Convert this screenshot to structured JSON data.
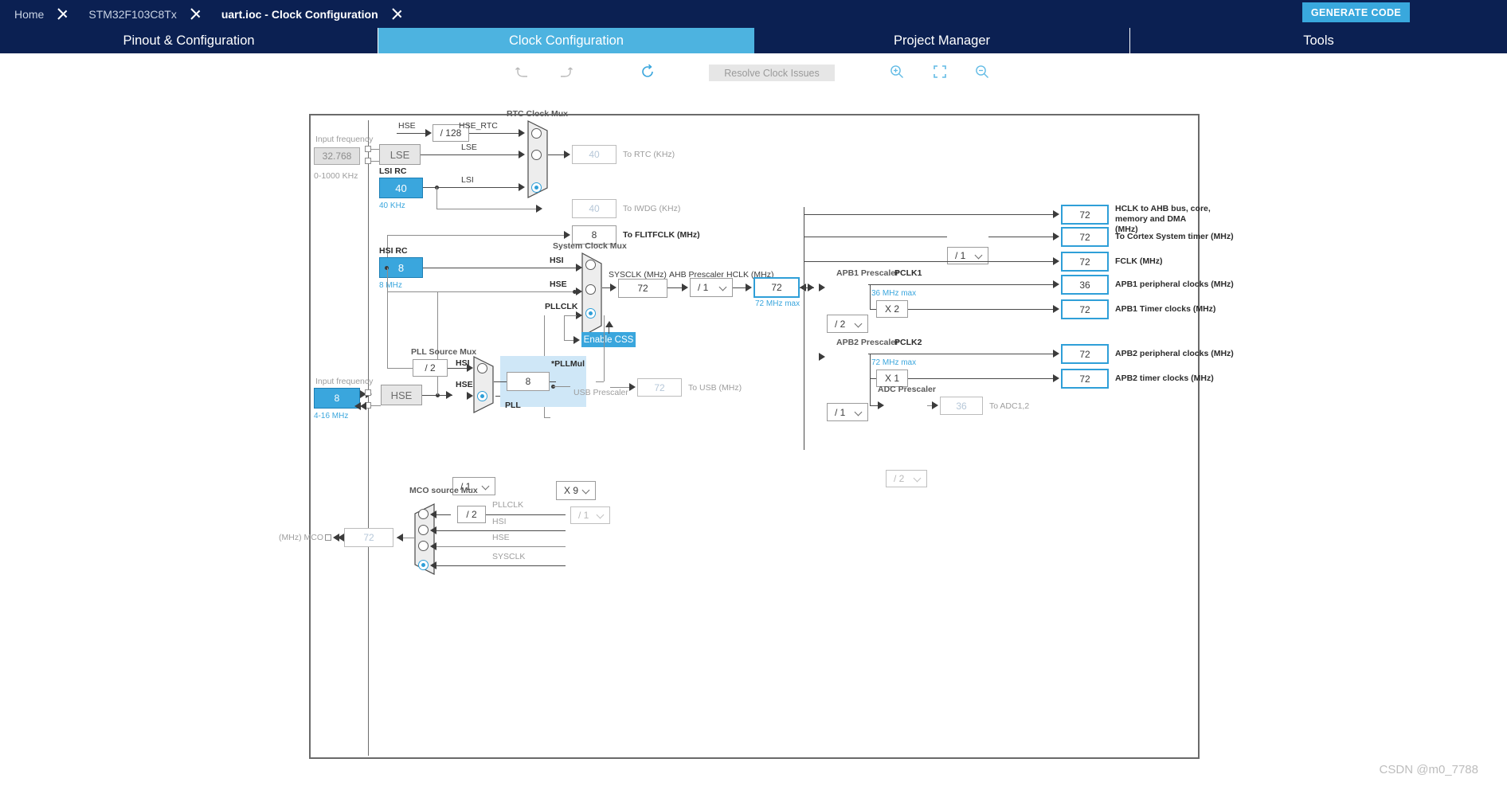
{
  "breadcrumb": {
    "items": [
      {
        "label": "Home",
        "active": false
      },
      {
        "label": "STM32F103C8Tx",
        "active": false
      },
      {
        "label": "uart.ioc - Clock Configuration",
        "active": true
      }
    ]
  },
  "header": {
    "generate_code_label": "GENERATE CODE",
    "accent_color": "#39a8dd",
    "bar_color": "#0b2052"
  },
  "tabs": [
    {
      "label": "Pinout & Configuration",
      "selected": false
    },
    {
      "label": "Clock Configuration",
      "selected": true
    },
    {
      "label": "Project Manager",
      "selected": false
    },
    {
      "label": "Tools",
      "selected": false
    }
  ],
  "toolbar": {
    "undo_icon": "undo-icon",
    "redo_icon": "redo-icon",
    "reset_icon": "reset-icon",
    "resolve_label": "Resolve Clock Issues",
    "resolve_enabled": false,
    "zoom_in_icon": "zoom-in-icon",
    "zoom_fit_icon": "zoom-fit-icon",
    "zoom_out_icon": "zoom-out-icon"
  },
  "diagram": {
    "lse": {
      "input_frequency_label": "Input frequency",
      "input_frequency_value": "32.768",
      "range_label": "0-1000 KHz",
      "osc_label": "LSE"
    },
    "lsi": {
      "title": "LSI RC",
      "value": "40",
      "unit_label": "40 KHz"
    },
    "hse_div": {
      "source_label": "HSE",
      "value": "/ 128",
      "out_label": "HSE_RTC"
    },
    "rtc_mux": {
      "title": "RTC Clock Mux",
      "inputs": [
        "HSE_RTC",
        "LSE",
        "LSI"
      ],
      "selected_index": 2
    },
    "outputs_left": [
      {
        "value": "40",
        "label": "To RTC (KHz)",
        "style": "dim"
      },
      {
        "value": "40",
        "label": "To IWDG (KHz)",
        "style": "dim"
      },
      {
        "value": "8",
        "label": "To FLITFCLK (MHz)",
        "style": "normal"
      }
    ],
    "hsi": {
      "title": "HSI RC",
      "value": "8",
      "unit_label": "8 MHz"
    },
    "hse": {
      "input_frequency_label": "Input frequency",
      "input_frequency_value": "8",
      "range_label": "4-16 MHz",
      "osc_label": "HSE"
    },
    "sysclk_mux": {
      "title": "System Clock Mux",
      "inputs": [
        "HSI",
        "HSE",
        "PLLCLK"
      ],
      "selected_index": 2
    },
    "enable_css_label": "Enable CSS",
    "sysclk": {
      "label": "SYSCLK (MHz)",
      "value": "72"
    },
    "ahb_prescaler": {
      "label": "AHB Prescaler",
      "value": "/ 1"
    },
    "hclk": {
      "label": "HCLK (MHz)",
      "value": "72",
      "max_label": "72 MHz max"
    },
    "pll": {
      "source_mux_title": "PLL Source Mux",
      "hsi_div_value": "/ 2",
      "hsi_label": "HSI",
      "hse_div_value": "/ 1",
      "hse_label": "HSE",
      "selected_index": 1,
      "pll_input_value": "8",
      "pllmul_label": "*PLLMul",
      "pllmul_value": "X 9",
      "region_label": "PLL"
    },
    "usb": {
      "title": "USB Prescaler",
      "prescaler_value": "/ 1",
      "value": "72",
      "label": "To USB (MHz)"
    },
    "right_outputs": [
      {
        "value": "72",
        "label": "HCLK to AHB bus, core, memory and DMA (MHz)"
      },
      {
        "value": "72",
        "label": "To Cortex System timer (MHz)",
        "prescaler": "/ 1"
      },
      {
        "value": "72",
        "label": "FCLK (MHz)"
      }
    ],
    "apb1": {
      "prescaler_title": "APB1 Prescaler",
      "prescaler_value": "/ 2",
      "pclk_label": "PCLK1",
      "max_label": "36 MHz max",
      "peripheral_value": "36",
      "peripheral_label": "APB1 peripheral clocks (MHz)",
      "timer_mul": "X 2",
      "timer_value": "72",
      "timer_label": "APB1 Timer clocks (MHz)"
    },
    "apb2": {
      "prescaler_title": "APB2 Prescaler",
      "prescaler_value": "/ 1",
      "pclk_label": "PCLK2",
      "max_label": "72 MHz max",
      "peripheral_value": "72",
      "peripheral_label": "APB2 peripheral clocks (MHz)",
      "timer_mul": "X 1",
      "timer_value": "72",
      "timer_label": "APB2 timer clocks (MHz)",
      "adc_prescaler_title": "ADC Prescaler",
      "adc_prescaler_value": "/ 2",
      "adc_value": "36",
      "adc_label": "To ADC1,2"
    },
    "mco": {
      "title": "MCO source Mux",
      "out_label": "(MHz) MCO",
      "value": "72",
      "pll_div_value": "/ 2",
      "inputs": [
        "PLLCLK",
        "HSI",
        "HSE",
        "SYSCLK"
      ],
      "selected_index": 3
    }
  },
  "watermark": "CSDN @m0_7788"
}
